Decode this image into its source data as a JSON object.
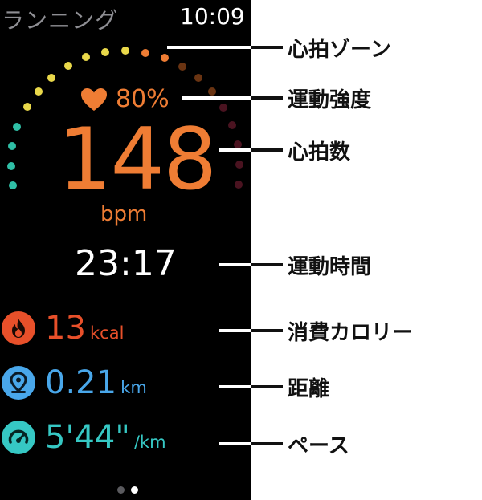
{
  "app": {
    "title": "ランニング",
    "time": "10:09"
  },
  "heart_rate": {
    "intensity": "80%",
    "value": "148",
    "unit": "bpm"
  },
  "workout": {
    "duration": "23:17"
  },
  "metrics": [
    {
      "value": "13",
      "unit": "kcal",
      "icon": "flame-icon",
      "color": "#e8502a"
    },
    {
      "value": "0.21",
      "unit": "km",
      "icon": "location-pin-icon",
      "color": "#49a7ea"
    },
    {
      "value": "5'44\"",
      "unit": "/km",
      "icon": "speedometer-icon",
      "color": "#36c8c4"
    }
  ],
  "annotations": {
    "heart_rate_zone": "心拍ゾーン",
    "intensity": "運動強度",
    "heart_rate": "心拍数",
    "duration": "運動時間",
    "calories": "消費カロリー",
    "distance": "距離",
    "pace": "ペース"
  },
  "colors": {
    "accent": "#ef7d34",
    "calories": "#e8502a",
    "distance": "#49a7ea",
    "pace": "#36c8c4"
  },
  "page_indicator": {
    "count": 2,
    "active": 2
  }
}
